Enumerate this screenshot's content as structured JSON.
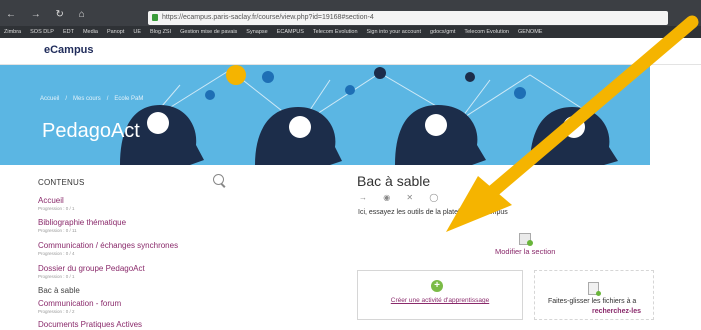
{
  "browser": {
    "nav_glyphs": "← → ↻ ⌂",
    "url": "https://ecampus.paris-saclay.fr/course/view.php?id=19168#section-4",
    "bookmarks": [
      "Zimbra",
      "SOS DLP",
      "EDT",
      "Media",
      "Panopt",
      "UE",
      "Blog ZSI",
      "Gestion mise de pavais",
      "Synapse",
      "ECAMPUS",
      "Telecom Evolution",
      "Sign into your account",
      "gdocs/gmt",
      "Telecom Evolution",
      "GENOME"
    ]
  },
  "site": {
    "logo": "eCampus"
  },
  "banner": {
    "breadcrumb": [
      "Accueil",
      "/",
      "Mes cours",
      "/",
      "Ecole PaM"
    ],
    "title": "PedagoAct"
  },
  "sidebar": {
    "heading": "CONTENUS",
    "items": [
      {
        "label": "Accueil",
        "sub": "Progression : 0 / 1"
      },
      {
        "label": "Bibliographie thématique",
        "sub": "Progression : 0 / 11"
      },
      {
        "label": "Communication / échanges synchrones",
        "sub": "Progression : 0 / 4"
      },
      {
        "label": "Dossier du groupe PedagoAct",
        "sub": "Progression : 0 / 1"
      },
      {
        "label": "Bac à sable",
        "sub": ""
      },
      {
        "label": "Communication - forum",
        "sub": "Progression : 0 / 2"
      },
      {
        "label": "Documents Pratiques Actives",
        "sub": ""
      }
    ]
  },
  "section": {
    "title": "Bac à sable",
    "icons": "→ ◉ ✕ ◯",
    "description": "Ici, essayez les outils de la plateforme eCampus",
    "modify_link": "Modifier la section",
    "create_activity": "Créer une activité d'apprentissage",
    "drop_text": "Faites-glisser les fichiers à a",
    "drop_link": "recherchez-les"
  },
  "annotation": {
    "arrow_color": "#f5b400"
  }
}
